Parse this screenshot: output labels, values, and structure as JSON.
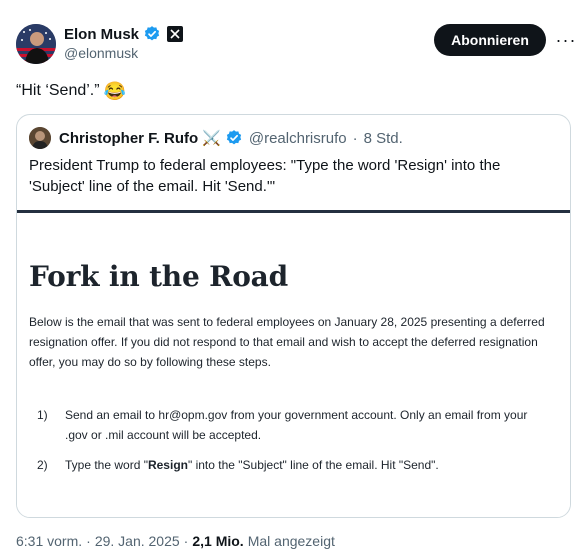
{
  "author": {
    "name": "Elon Musk",
    "handle": "@elonmusk",
    "verified_icon": "verified-badge-icon",
    "affiliate_icon": "x-logo-icon"
  },
  "actions": {
    "follow_label": "Abonnieren",
    "more_label": "···"
  },
  "tweet": {
    "text": "“Hit ‘Send’.”",
    "emoji": "😂"
  },
  "quote": {
    "name": "Christopher F. Rufo",
    "name_emoji": "⚔️",
    "handle": "@realchrisrufo",
    "separator": "·",
    "time": "8 Std.",
    "text": "President Trump to federal employees: \"Type the word 'Resign' into the 'Subject' line of the email. Hit 'Send.'\"",
    "document": {
      "title": "Fork in the Road",
      "intro": "Below is the email that was sent to federal employees on January 28, 2025 presenting a deferred resignation offer. If you did not respond to that email and wish to accept the deferred resignation offer, you may do so by following these steps.",
      "steps": [
        {
          "num": "1)",
          "text": "Send an email to hr@opm.gov from your government account. Only an email from your .gov or .mil account will be accepted."
        },
        {
          "num": "2)",
          "pre": "Type the word \"",
          "bold": "Resign",
          "post": "\" into the \"Subject\" line of the email. Hit \"Send\"."
        }
      ]
    }
  },
  "footer": {
    "time": "6:31 vorm.",
    "dot": "·",
    "date": "29. Jan. 2025",
    "dot2": "·",
    "views": "2,1 Mio.",
    "views_label": "Mal angezeigt"
  },
  "colors": {
    "text": "#0f1419",
    "secondary": "#536471",
    "verified": "#1d9bf0",
    "border": "#cfd9de"
  }
}
